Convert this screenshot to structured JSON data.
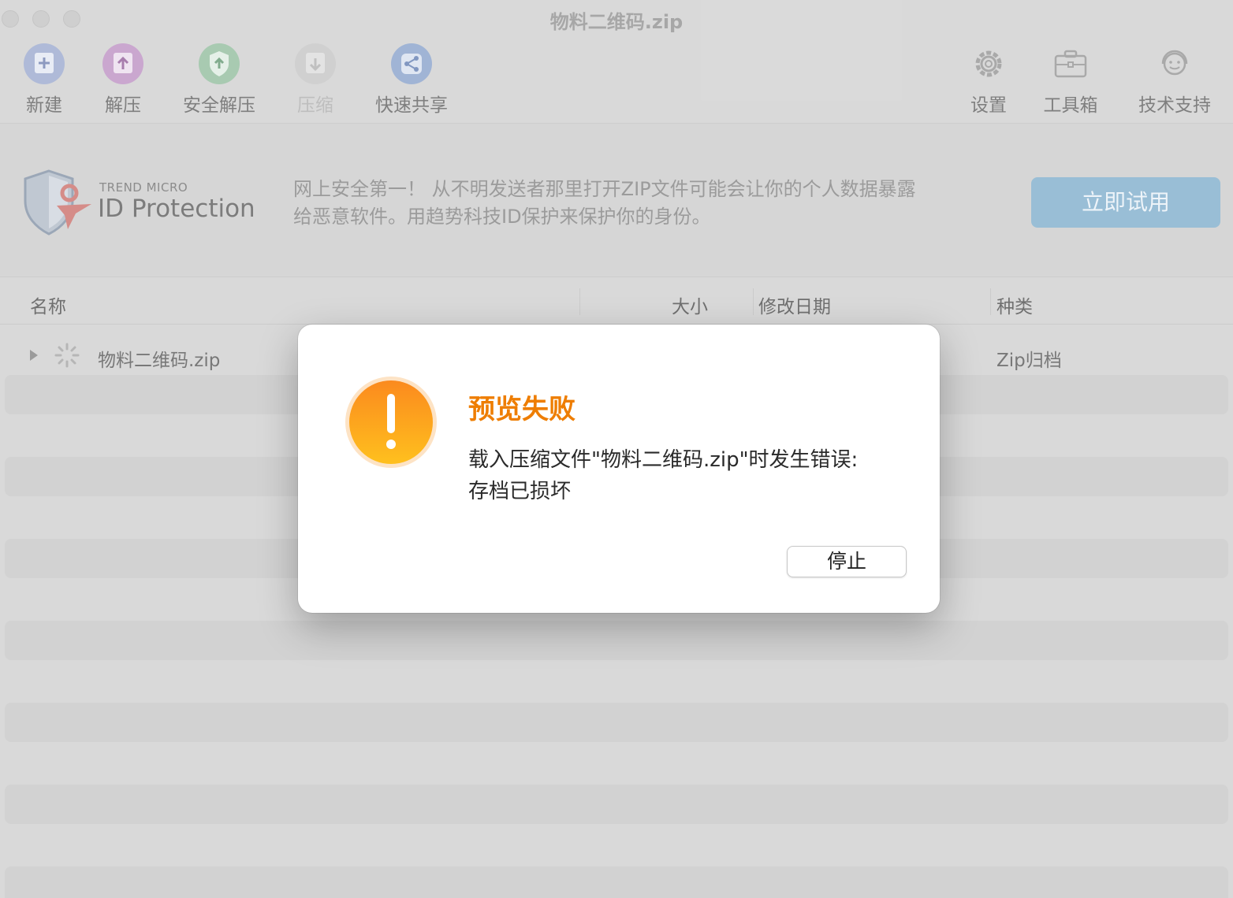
{
  "window": {
    "title": "物料二维码.zip"
  },
  "toolbar": {
    "items": [
      {
        "label": "新建",
        "icon": "new-archive-icon",
        "enabled": true
      },
      {
        "label": "解压",
        "icon": "extract-icon",
        "enabled": true
      },
      {
        "label": "安全解压",
        "icon": "secure-extract-icon",
        "enabled": true
      },
      {
        "label": "压缩",
        "icon": "compress-icon",
        "enabled": false
      },
      {
        "label": "快速共享",
        "icon": "share-icon",
        "enabled": true
      },
      {
        "label": "设置",
        "icon": "gear-icon",
        "enabled": true
      },
      {
        "label": "工具箱",
        "icon": "toolbox-icon",
        "enabled": true
      },
      {
        "label": "技术支持",
        "icon": "support-icon",
        "enabled": true
      }
    ]
  },
  "banner": {
    "brand_top": "TREND MICRO",
    "brand_name": "ID Protection",
    "text_line1": "网上安全第一！ 从不明发送者那里打开ZIP文件可能会让你的个人数据暴露",
    "text_line2": "给恶意软件。用趋势科技ID保护来保护你的身份。",
    "button": "立即试用"
  },
  "table": {
    "columns": [
      "名称",
      "大小",
      "修改日期",
      "种类"
    ],
    "rows": [
      {
        "name": "物料二维码.zip",
        "kind": "Zip归档"
      }
    ]
  },
  "dialog": {
    "title": "预览失败",
    "message_line1": "载入压缩文件\"物料二维码.zip\"时发生错误:",
    "message_line2": "存档已损坏",
    "button": "停止"
  },
  "colors": {
    "accent_orange": "#ee7d00",
    "try_button": "#97bdd6"
  }
}
